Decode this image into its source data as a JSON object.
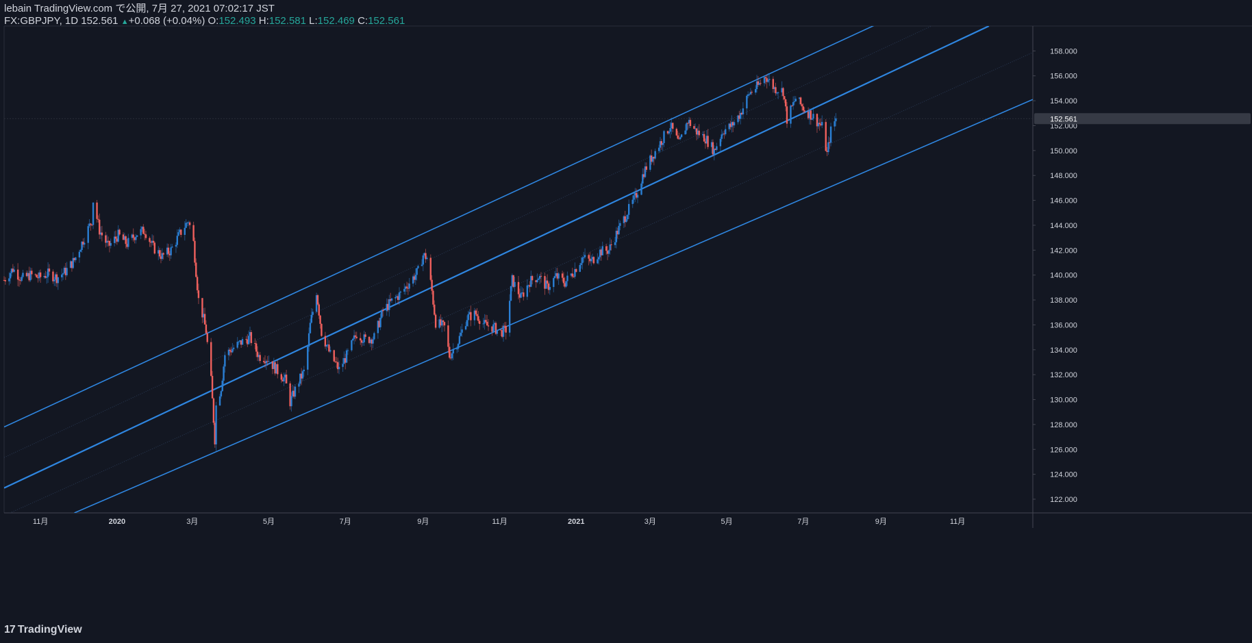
{
  "header": {
    "publisher_line": "lebain TradingView.com で公開, 7月 27, 2021 07:02:17 JST",
    "symbol": "FX:GBPJPY, 1D",
    "last": "152.561",
    "change": "+0.068 (+0.04%)",
    "o_label": "O:",
    "o": "152.493",
    "h_label": "H:",
    "h": "152.581",
    "l_label": "L:",
    "l": "152.469",
    "c_label": "C:",
    "c": "152.561"
  },
  "brand": {
    "logo_mark": "17",
    "name": "TradingView"
  },
  "colors": {
    "background": "#131722",
    "up": "#2a7fd4",
    "down": "#f0605d",
    "channel": "#2f86e0",
    "axis_text": "#d1d4dc",
    "price_label_bg": "#363a45"
  },
  "chart_data": {
    "type": "candlestick",
    "symbol": "FX:GBPJPY",
    "interval": "1D",
    "x_range": [
      "2019-10-03",
      "2021-12-31"
    ],
    "y_range": [
      120.9,
      160.0
    ],
    "y_ticks": [
      "122.000",
      "124.000",
      "126.000",
      "128.000",
      "130.000",
      "132.000",
      "134.000",
      "136.000",
      "138.000",
      "140.000",
      "142.000",
      "144.000",
      "146.000",
      "148.000",
      "150.000",
      "152.000",
      "154.000",
      "156.000",
      "158.000"
    ],
    "x_ticks": [
      {
        "label": "11月",
        "date": "2019-11-01"
      },
      {
        "label": "2020",
        "date": "2020-01-01"
      },
      {
        "label": "3月",
        "date": "2020-03-01"
      },
      {
        "label": "5月",
        "date": "2020-05-01"
      },
      {
        "label": "7月",
        "date": "2020-07-01"
      },
      {
        "label": "9月",
        "date": "2020-09-01"
      },
      {
        "label": "11月",
        "date": "2020-11-01"
      },
      {
        "label": "2021",
        "date": "2021-01-01"
      },
      {
        "label": "3月",
        "date": "2021-03-01"
      },
      {
        "label": "5月",
        "date": "2021-05-01"
      },
      {
        "label": "7月",
        "date": "2021-07-01"
      },
      {
        "label": "9月",
        "date": "2021-09-01"
      },
      {
        "label": "11月",
        "date": "2021-11-01"
      }
    ],
    "last_price_label": "152.561",
    "last_price": 152.561,
    "closes": [
      [
        "2019-10-03",
        139.6
      ],
      [
        "2019-10-10",
        140.5
      ],
      [
        "2019-10-17",
        139.7
      ],
      [
        "2019-10-24",
        140.0
      ],
      [
        "2019-10-31",
        139.8
      ],
      [
        "2019-11-07",
        140.1
      ],
      [
        "2019-11-14",
        139.8
      ],
      [
        "2019-11-21",
        140.3
      ],
      [
        "2019-11-28",
        141.2
      ],
      [
        "2019-12-05",
        142.8
      ],
      [
        "2019-12-12",
        144.4
      ],
      [
        "2019-12-13",
        146.0
      ],
      [
        "2019-12-18",
        143.6
      ],
      [
        "2019-12-25",
        142.3
      ],
      [
        "2020-01-02",
        143.2
      ],
      [
        "2020-01-09",
        142.5
      ],
      [
        "2020-01-16",
        143.3
      ],
      [
        "2020-01-23",
        143.6
      ],
      [
        "2020-01-30",
        142.2
      ],
      [
        "2020-02-06",
        141.5
      ],
      [
        "2020-02-13",
        142.0
      ],
      [
        "2020-02-20",
        143.3
      ],
      [
        "2020-02-27",
        144.4
      ],
      [
        "2020-03-02",
        142.6
      ],
      [
        "2020-03-06",
        138.0
      ],
      [
        "2020-03-09",
        136.9
      ],
      [
        "2020-03-12",
        135.5
      ],
      [
        "2020-03-16",
        131.5
      ],
      [
        "2020-03-19",
        126.8
      ],
      [
        "2020-03-20",
        129.5
      ],
      [
        "2020-03-24",
        131.0
      ],
      [
        "2020-03-27",
        133.6
      ],
      [
        "2020-04-02",
        134.1
      ],
      [
        "2020-04-09",
        134.6
      ],
      [
        "2020-04-16",
        135.0
      ],
      [
        "2020-04-23",
        133.5
      ],
      [
        "2020-04-30",
        133.3
      ],
      [
        "2020-05-07",
        132.4
      ],
      [
        "2020-05-14",
        131.6
      ],
      [
        "2020-05-18",
        129.8
      ],
      [
        "2020-05-25",
        131.5
      ],
      [
        "2020-05-30",
        132.4
      ],
      [
        "2020-06-03",
        136.0
      ],
      [
        "2020-06-08",
        138.7
      ],
      [
        "2020-06-12",
        135.4
      ],
      [
        "2020-06-19",
        133.6
      ],
      [
        "2020-06-26",
        132.4
      ],
      [
        "2020-07-03",
        133.7
      ],
      [
        "2020-07-10",
        135.3
      ],
      [
        "2020-07-17",
        134.8
      ],
      [
        "2020-07-24",
        135.0
      ],
      [
        "2020-07-31",
        137.1
      ],
      [
        "2020-08-07",
        137.9
      ],
      [
        "2020-08-14",
        138.5
      ],
      [
        "2020-08-21",
        139.4
      ],
      [
        "2020-08-28",
        140.3
      ],
      [
        "2020-09-01",
        141.6
      ],
      [
        "2020-09-04",
        141.4
      ],
      [
        "2020-09-08",
        138.7
      ],
      [
        "2020-09-11",
        136.2
      ],
      [
        "2020-09-18",
        135.8
      ],
      [
        "2020-09-22",
        133.5
      ],
      [
        "2020-09-29",
        134.7
      ],
      [
        "2020-10-06",
        136.6
      ],
      [
        "2020-10-13",
        136.9
      ],
      [
        "2020-10-20",
        136.0
      ],
      [
        "2020-10-27",
        135.8
      ],
      [
        "2020-11-02",
        135.4
      ],
      [
        "2020-11-06",
        135.6
      ],
      [
        "2020-11-11",
        139.6
      ],
      [
        "2020-11-18",
        138.2
      ],
      [
        "2020-11-25",
        139.5
      ],
      [
        "2020-12-02",
        139.9
      ],
      [
        "2020-12-09",
        139.0
      ],
      [
        "2020-12-16",
        139.9
      ],
      [
        "2020-12-23",
        139.4
      ],
      [
        "2020-12-30",
        140.3
      ],
      [
        "2021-01-06",
        141.4
      ],
      [
        "2021-01-13",
        141.1
      ],
      [
        "2021-01-20",
        141.9
      ],
      [
        "2021-01-27",
        142.0
      ],
      [
        "2021-02-03",
        143.5
      ],
      [
        "2021-02-10",
        144.9
      ],
      [
        "2021-02-17",
        146.2
      ],
      [
        "2021-02-24",
        148.3
      ],
      [
        "2021-03-03",
        149.6
      ],
      [
        "2021-03-10",
        150.8
      ],
      [
        "2021-03-17",
        152.0
      ],
      [
        "2021-03-24",
        150.5
      ],
      [
        "2021-03-31",
        152.4
      ],
      [
        "2021-04-07",
        151.5
      ],
      [
        "2021-04-14",
        151.0
      ],
      [
        "2021-04-21",
        150.0
      ],
      [
        "2021-04-28",
        151.6
      ],
      [
        "2021-05-05",
        152.0
      ],
      [
        "2021-05-12",
        153.0
      ],
      [
        "2021-05-19",
        154.6
      ],
      [
        "2021-05-26",
        155.2
      ],
      [
        "2021-06-01",
        156.0
      ],
      [
        "2021-06-08",
        155.0
      ],
      [
        "2021-06-15",
        154.8
      ],
      [
        "2021-06-18",
        152.5
      ],
      [
        "2021-06-25",
        154.2
      ],
      [
        "2021-07-02",
        153.3
      ],
      [
        "2021-07-09",
        152.7
      ],
      [
        "2021-07-16",
        151.9
      ],
      [
        "2021-07-20",
        149.7
      ],
      [
        "2021-07-23",
        151.6
      ],
      [
        "2021-07-27",
        152.561
      ]
    ],
    "channel_lines": [
      {
        "name": "upper",
        "from": [
          "2019-10-03",
          127.8
        ],
        "to": [
          "2021-09-01",
          160.3
        ]
      },
      {
        "name": "middle",
        "from": [
          "2019-10-03",
          122.9
        ],
        "to": [
          "2021-11-26",
          160.0
        ]
      },
      {
        "name": "lower",
        "from": [
          "2019-11-28",
          120.9
        ],
        "to": [
          "2021-12-31",
          154.1
        ]
      }
    ],
    "grid": false
  }
}
